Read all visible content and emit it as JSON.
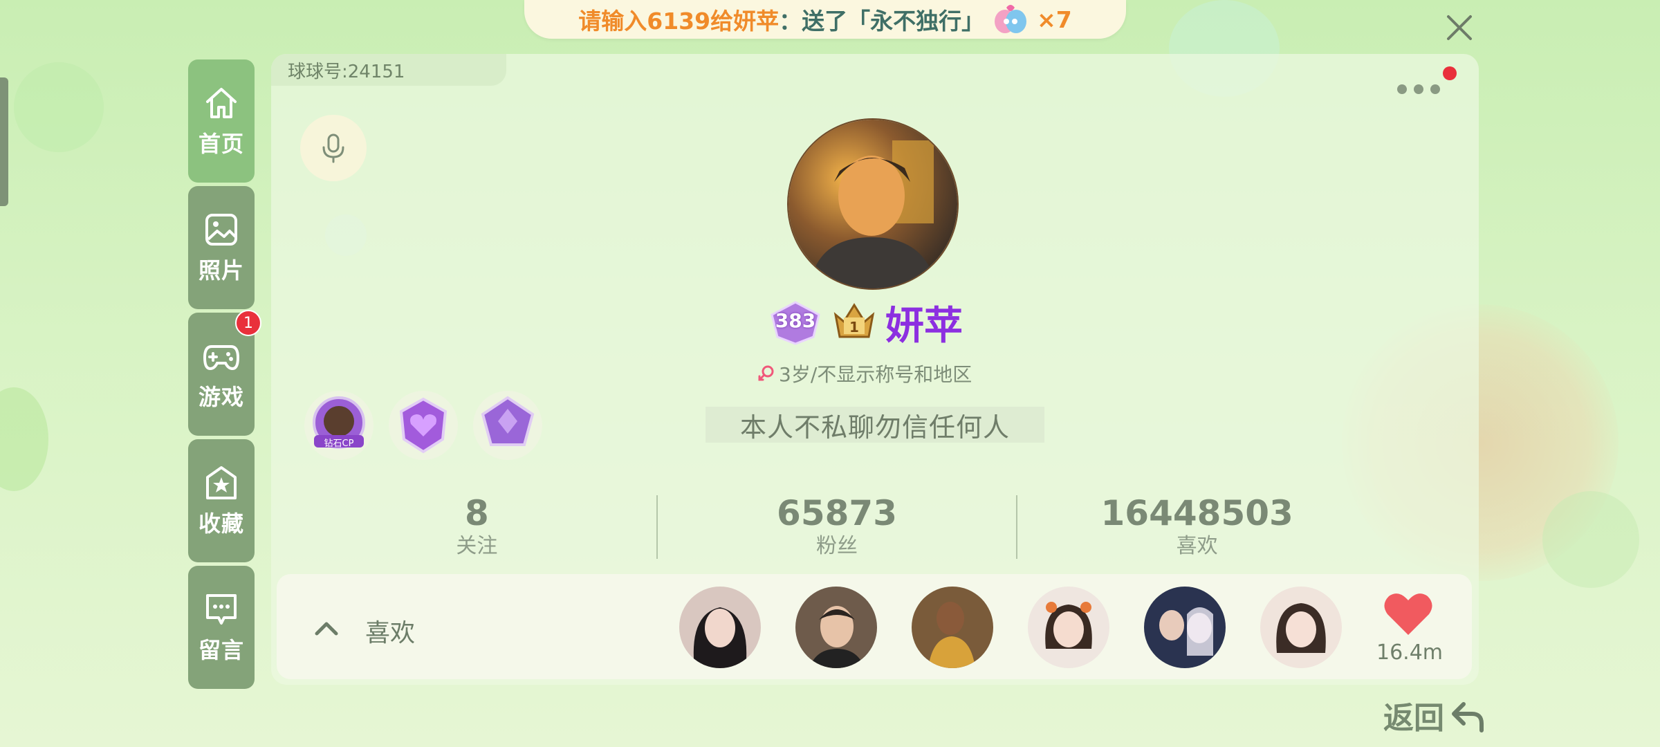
{
  "banner": {
    "part1": "请输入6139给",
    "name": "妍苹",
    "part2": "：送了「永不独行」",
    "count": "×7"
  },
  "close": {
    "icon": "close-icon"
  },
  "tabs": [
    {
      "label": "首页",
      "icon": "home-icon",
      "active": true
    },
    {
      "label": "照片",
      "icon": "photo-icon"
    },
    {
      "label": "游戏",
      "icon": "gamepad-icon",
      "badge": "1"
    },
    {
      "label": "收藏",
      "icon": "star-box-icon"
    },
    {
      "label": "留言",
      "icon": "message-icon"
    }
  ],
  "profile": {
    "id_text": "球球号:24151",
    "level": "383",
    "name": "妍苹",
    "info": "3岁/不显示称号和地区",
    "bio": "本人不私聊勿信任何人",
    "medal1_text": "钻石CP"
  },
  "stats": [
    {
      "value": "8",
      "label": "关注"
    },
    {
      "value": "65873",
      "label": "粉丝"
    },
    {
      "value": "16448503",
      "label": "喜欢"
    }
  ],
  "likes": {
    "label": "喜欢",
    "count": "16.4m"
  },
  "back": {
    "label": "返回"
  },
  "colors": {
    "accent": "#8cc27f",
    "name": "#8c2fe0",
    "banner_orange": "#f08b2a",
    "badge_red": "#e9303b"
  }
}
